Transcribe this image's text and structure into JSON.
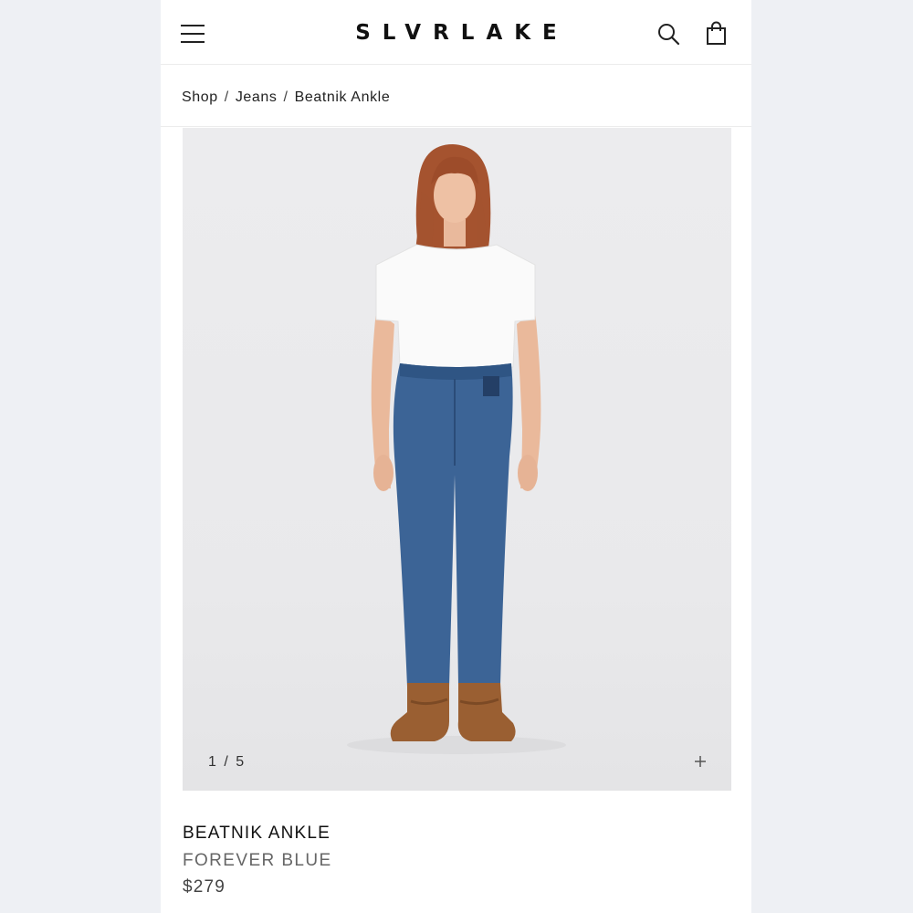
{
  "header": {
    "logo": "SLVRLAKE"
  },
  "breadcrumb": {
    "items": [
      "Shop",
      "Jeans",
      "Beatnik Ankle"
    ],
    "separator": "/"
  },
  "gallery": {
    "counter": "1 / 5",
    "current": 1,
    "total": 5
  },
  "product": {
    "name": "BEATNIK ANKLE",
    "color": "FOREVER BLUE",
    "price": "$279"
  },
  "icons": {
    "menu": "hamburger-menu-icon",
    "search": "search-icon",
    "bag": "shopping-bag-icon",
    "zoom": "plus-icon"
  }
}
